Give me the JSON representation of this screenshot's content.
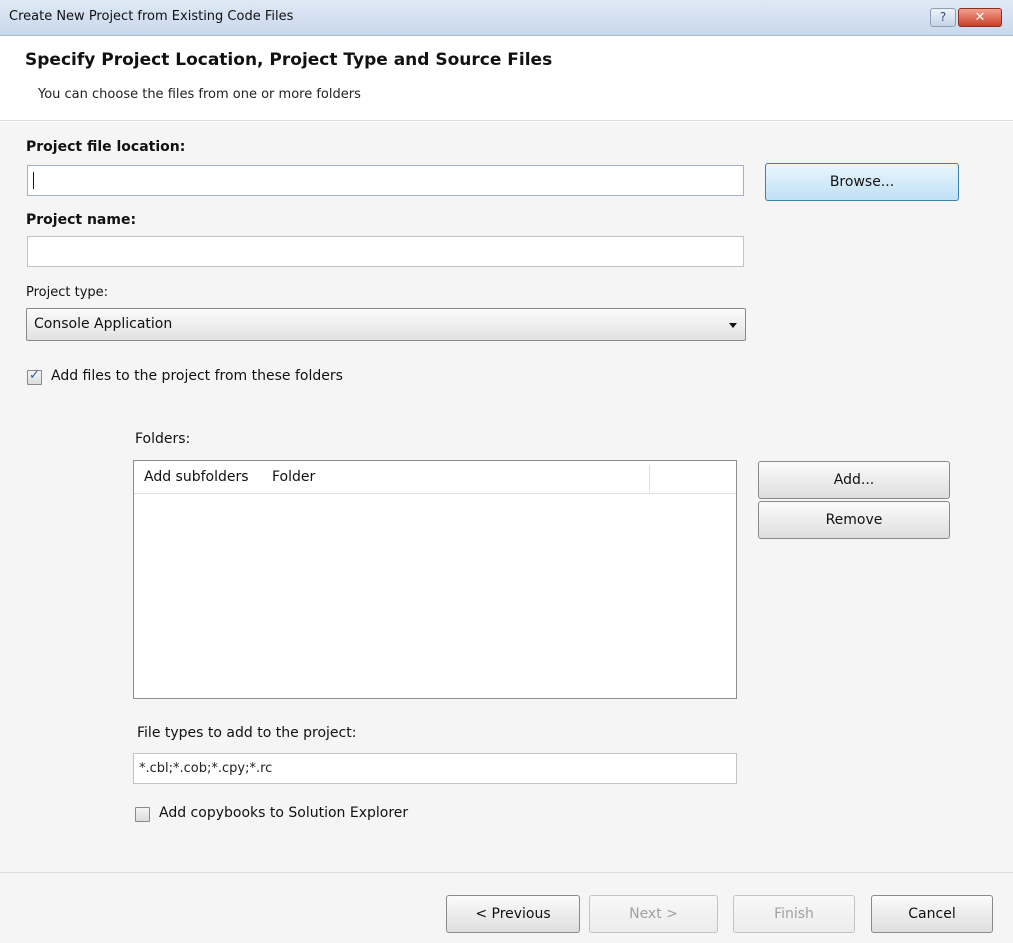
{
  "window": {
    "title": "Create New Project from Existing Code Files",
    "help_label": "?",
    "close_label": "✕"
  },
  "header": {
    "heading": "Specify Project Location, Project Type and Source Files",
    "subheading": "You can choose the files from one or more folders"
  },
  "form": {
    "project_file_location": {
      "label": "Project file location:",
      "value": "",
      "placeholder": ""
    },
    "browse_label": "Browse...",
    "project_name": {
      "label": "Project name:",
      "value": "",
      "placeholder": ""
    },
    "project_type": {
      "label": "Project type:",
      "selected": "Console Application"
    },
    "add_files_checkbox": {
      "label": "Add files to the project from these folders",
      "checked": true
    },
    "folders": {
      "label": "Folders:",
      "columns": [
        "Add subfolders",
        "Folder"
      ],
      "rows": []
    },
    "add_label": "Add...",
    "remove_label": "Remove",
    "file_types": {
      "label": "File types to add to the project:",
      "value": "*.cbl;*.cob;*.cpy;*.rc"
    },
    "copybooks_checkbox": {
      "label": "Add copybooks to Solution Explorer",
      "checked": false
    }
  },
  "footer": {
    "previous_label": "< Previous",
    "next_label": "Next >",
    "finish_label": "Finish",
    "cancel_label": "Cancel"
  },
  "icons": {
    "checkmark": "check-icon",
    "dropdown": "chevron-down-icon"
  }
}
